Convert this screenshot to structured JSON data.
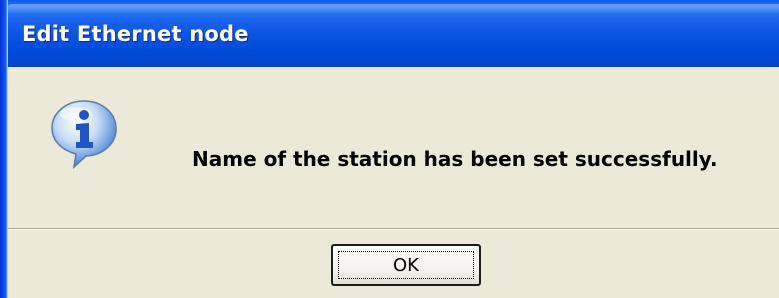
{
  "dialog": {
    "title": "Edit Ethernet node",
    "icon": "info-icon",
    "message": "Name of the station has been set successfully.",
    "ok_label": "OK"
  },
  "colors": {
    "title_bar": "#0a52e0",
    "dialog_face": "#ece9d8",
    "text": "#000000",
    "title_text": "#ffffff"
  }
}
